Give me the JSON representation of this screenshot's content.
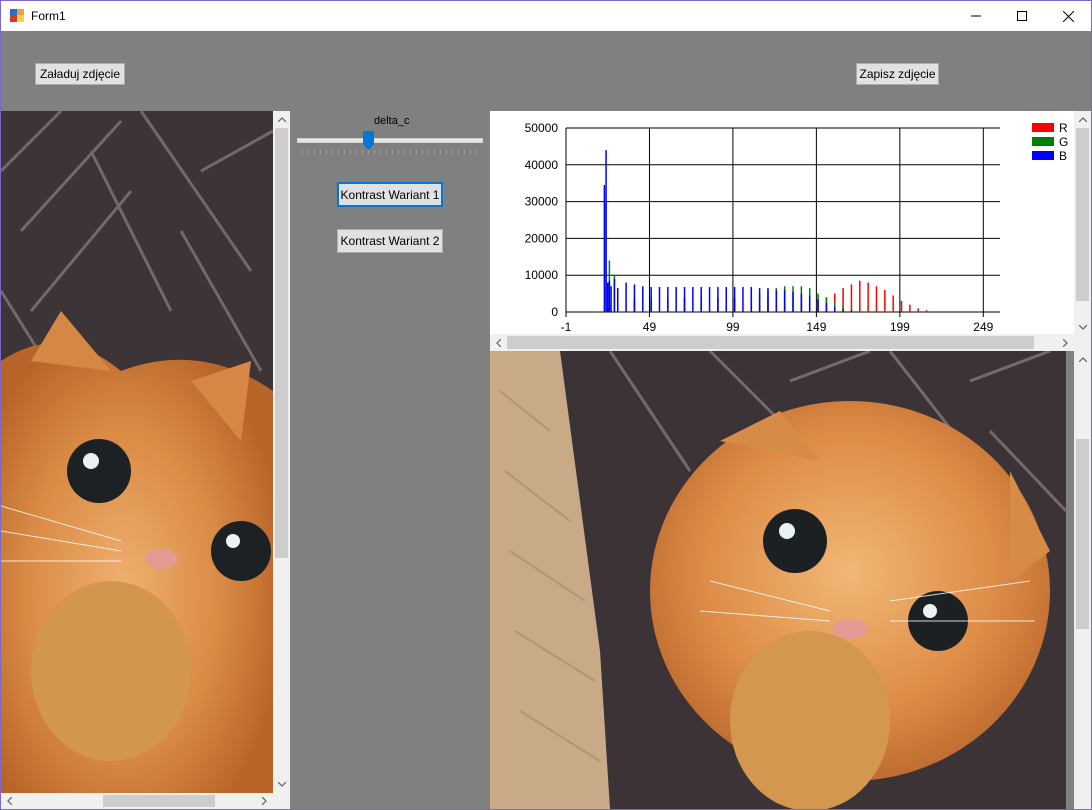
{
  "window": {
    "title": "Form1",
    "minimize_icon": "minimize-icon",
    "maximize_icon": "maximize-icon",
    "close_icon": "close-icon"
  },
  "toolbar": {
    "load_label": "Załaduj zdjęcie",
    "save_label": "Zapisz zdjęcie"
  },
  "controls": {
    "slider_label": "delta_c",
    "slider_value": 0.38,
    "button1_label": "Kontrast Wariant 1",
    "button2_label": "Kontrast Wariant 2"
  },
  "chart_data": {
    "type": "bar",
    "title": "",
    "xlabel": "",
    "ylabel": "",
    "xlim": [
      -1,
      259
    ],
    "ylim": [
      0,
      50000
    ],
    "xticks": [
      -1,
      49,
      99,
      149,
      199,
      249
    ],
    "yticks": [
      0,
      10000,
      20000,
      30000,
      40000,
      50000
    ],
    "grid": true,
    "legend_position": "top-right",
    "colors": {
      "R": "#ff0000",
      "G": "#008000",
      "B": "#0000ff"
    },
    "series": [
      {
        "name": "R",
        "x": [
          25,
          30,
          40,
          50,
          60,
          70,
          80,
          90,
          100,
          110,
          120,
          130,
          140,
          150,
          155,
          160,
          165,
          170,
          175,
          180,
          185,
          190,
          195,
          200,
          205,
          210,
          215
        ],
        "values": [
          1500,
          2500,
          3000,
          3500,
          3500,
          3500,
          3500,
          3500,
          3500,
          3500,
          3500,
          3500,
          3500,
          3500,
          4000,
          5000,
          6500,
          7500,
          8500,
          8000,
          7000,
          6000,
          4500,
          3000,
          2000,
          1000,
          500
        ]
      },
      {
        "name": "G",
        "x": [
          23,
          25,
          28,
          30,
          40,
          50,
          60,
          70,
          80,
          90,
          100,
          110,
          115,
          120,
          125,
          130,
          135,
          140,
          145,
          150,
          155,
          160,
          165,
          170,
          175
        ],
        "values": [
          30000,
          14000,
          10000,
          5000,
          4000,
          4000,
          4000,
          4000,
          4000,
          4000,
          4000,
          4500,
          5000,
          6000,
          6500,
          7000,
          7000,
          7000,
          6500,
          5000,
          4000,
          2500,
          1500,
          800,
          300
        ]
      },
      {
        "name": "B",
        "x": [
          22,
          23,
          24,
          25,
          26,
          28,
          30,
          35,
          40,
          45,
          50,
          55,
          60,
          65,
          70,
          75,
          80,
          85,
          90,
          95,
          100,
          105,
          110,
          115,
          120,
          125,
          130,
          135,
          140,
          145,
          150,
          155,
          160,
          165,
          170
        ],
        "values": [
          34500,
          44000,
          8000,
          8500,
          7000,
          9000,
          6500,
          8000,
          7500,
          7000,
          6800,
          6800,
          6800,
          6800,
          6800,
          6800,
          6800,
          6800,
          6800,
          6800,
          6800,
          6800,
          6800,
          6500,
          6500,
          6000,
          6000,
          5500,
          5000,
          4500,
          3500,
          2500,
          1500,
          800,
          300
        ]
      }
    ]
  }
}
